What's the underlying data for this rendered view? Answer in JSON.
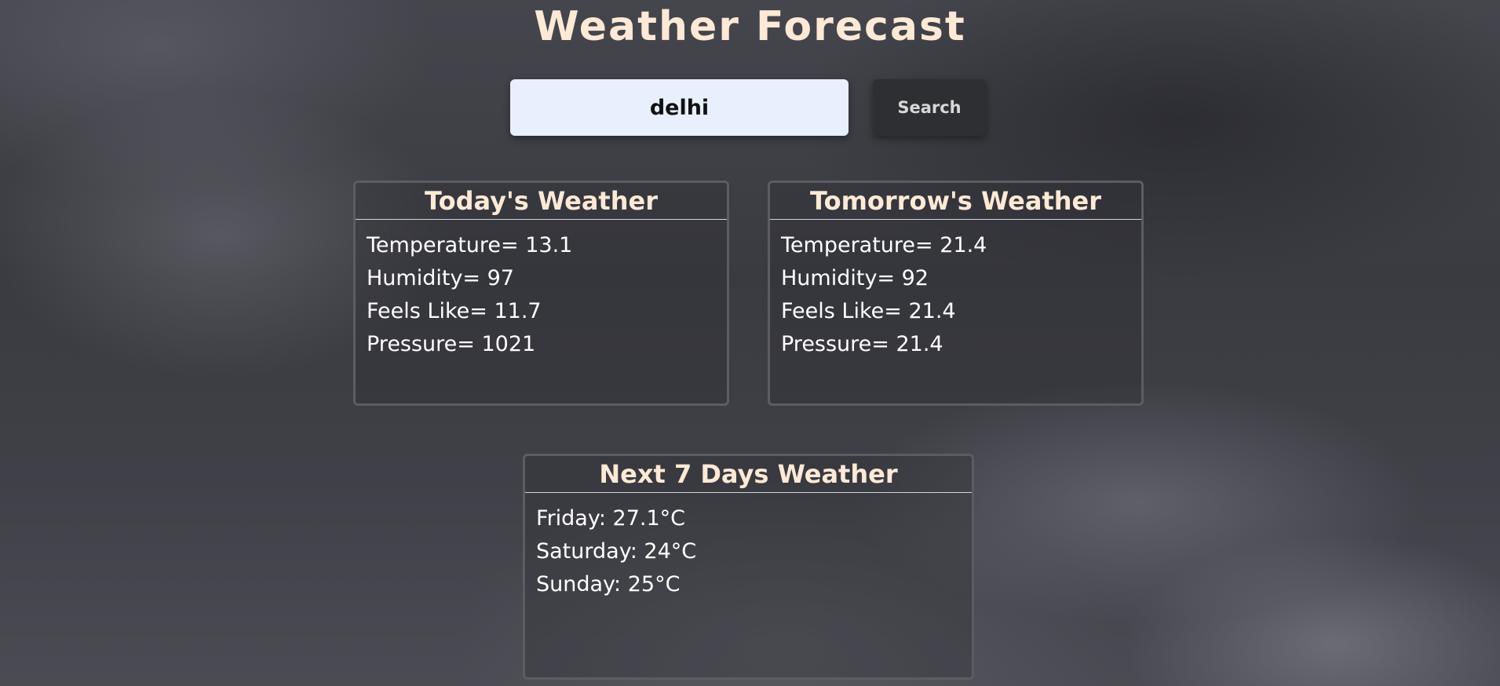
{
  "header": {
    "title": "Weather Forecast"
  },
  "search": {
    "value": "delhi",
    "button_label": "Search"
  },
  "today": {
    "title": "Today's Weather",
    "temperature": "Temperature= 13.1",
    "humidity": "Humidity= 97",
    "feels_like": "Feels Like= 11.7",
    "pressure": "Pressure= 1021"
  },
  "tomorrow": {
    "title": "Tomorrow's Weather",
    "temperature": "Temperature= 21.4",
    "humidity": "Humidity= 92",
    "feels_like": "Feels Like= 21.4",
    "pressure": "Pressure= 21.4"
  },
  "week": {
    "title": "Next 7 Days Weather",
    "days": [
      "Friday: 27.1°C",
      "Saturday: 24°C",
      "Sunday: 25°C"
    ]
  },
  "colors": {
    "title": "#fde9d6",
    "input_background": "#e8f0fe",
    "button_background": "#2e2f33",
    "card_border": "#5c5d63"
  }
}
